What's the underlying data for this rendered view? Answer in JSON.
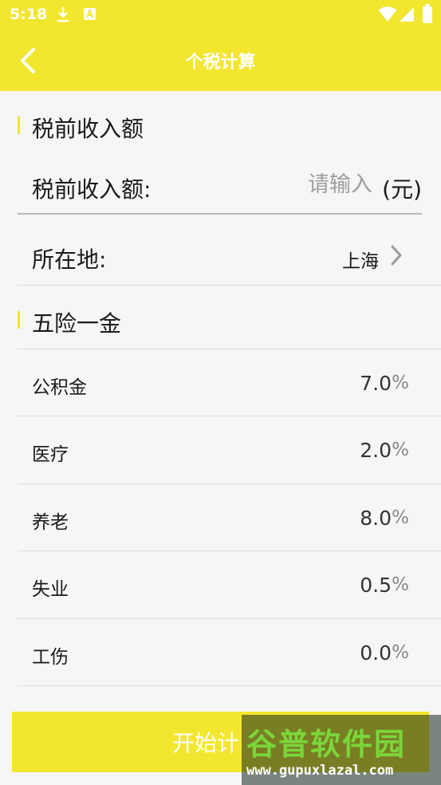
{
  "status_bar": {
    "time": "5:18",
    "icons": [
      "download-icon",
      "a-badge-icon",
      "wifi-icon",
      "signal-icon",
      "battery-icon"
    ],
    "background": "#f3e62e"
  },
  "header": {
    "title": "个税计算",
    "back_icon": "chevron-left-icon"
  },
  "income_section": {
    "title": "税前收入额",
    "input_label": "税前收入额:",
    "input_placeholder": "请输入",
    "input_value": "",
    "unit": "(元)"
  },
  "location": {
    "label": "所在地:",
    "value": "上海",
    "icon": "chevron-right-icon"
  },
  "insurance_section": {
    "title": "五险一金",
    "items": [
      {
        "label": "公积金",
        "value": "7.0",
        "unit": "%"
      },
      {
        "label": "医疗",
        "value": "2.0",
        "unit": "%"
      },
      {
        "label": "养老",
        "value": "8.0",
        "unit": "%"
      },
      {
        "label": "失业",
        "value": "0.5",
        "unit": "%"
      },
      {
        "label": "工伤",
        "value": "0.0",
        "unit": "%"
      }
    ]
  },
  "actions": {
    "start_button": "开始计"
  },
  "watermark": {
    "title": "谷普软件园",
    "url": "www.gupuxlazal.com"
  },
  "colors": {
    "accent": "#f3e62e",
    "text": "#1a1a1a",
    "placeholder": "#9e9e9e",
    "divider": "#dcdcdc"
  }
}
